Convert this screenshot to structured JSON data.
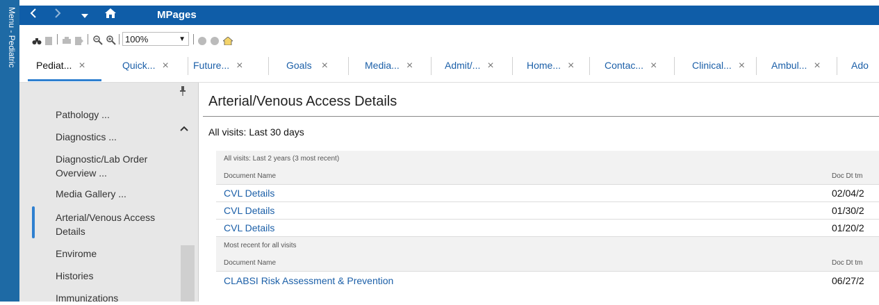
{
  "page_header": "MPages",
  "menu_strip": {
    "label": "Menu - Pediatric"
  },
  "nav": {
    "back_icon": "chevron-left-icon",
    "forward_icon": "chevron-right-icon",
    "dropdown_icon": "caret-down-icon",
    "home_icon": "home-icon",
    "title": "MPages",
    "bar_color": "#0f5da8"
  },
  "toolbar": {
    "zoom": "100%"
  },
  "tabs": [
    {
      "label": "Pediat...",
      "close": "×"
    },
    {
      "label": "Quick...",
      "close": "×"
    },
    {
      "label": "Future...",
      "close": "×"
    },
    {
      "label": "Goals",
      "close": "×"
    },
    {
      "label": "Media...",
      "close": "×"
    },
    {
      "label": "Admit/...",
      "close": "×"
    },
    {
      "label": "Home...",
      "close": "×"
    },
    {
      "label": "Contac...",
      "close": "×"
    },
    {
      "label": "Clinical...",
      "close": "×"
    },
    {
      "label": "Ambul...",
      "close": "×"
    },
    {
      "label": "Ado",
      "close": ""
    }
  ],
  "left_nav": {
    "items": [
      "Pathology ...",
      "Diagnostics ...",
      "Diagnostic/Lab Order",
      "Overview ...",
      "Media Gallery ...",
      "Arterial/Venous Access",
      "Details",
      "Envirome",
      "Histories",
      "Immunizations"
    ],
    "pin_icon": "pin-icon",
    "scroll_up_icon": "chevron-up-icon"
  },
  "main": {
    "title": "Arterial/Venous Access Details",
    "filter": "All visits: Last 30 days",
    "groups": [
      {
        "label": "All visits: Last 2 years (3 most recent)",
        "col_doc": "Document Name",
        "col_dt": "Doc Dt tm",
        "rows": [
          {
            "doc": "CVL Details",
            "dt": "02/04/2"
          },
          {
            "doc": "CVL Details",
            "dt": "01/30/2"
          },
          {
            "doc": "CVL Details",
            "dt": "01/20/2"
          }
        ]
      },
      {
        "label": "Most recent for all visits",
        "col_doc": "Document Name",
        "col_dt": "Doc Dt tm",
        "rows": [
          {
            "doc": "CLABSI Risk Assessment & Prevention",
            "dt": "06/27/2"
          }
        ]
      }
    ]
  }
}
